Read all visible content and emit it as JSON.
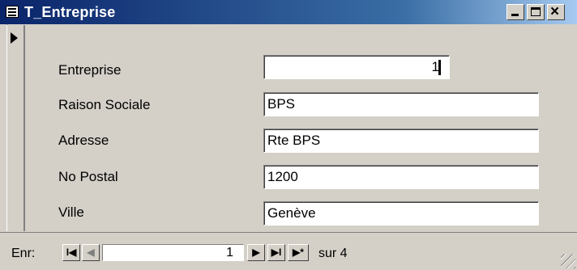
{
  "window": {
    "title": "T_Entreprise",
    "controls": {
      "close_glyph": "×"
    }
  },
  "form": {
    "fields": [
      {
        "label": "Entreprise",
        "value": "1"
      },
      {
        "label": "Raison Sociale",
        "value": "BPS"
      },
      {
        "label": "Adresse",
        "value": "Rte BPS"
      },
      {
        "label": "No Postal",
        "value": "1200"
      },
      {
        "label": "Ville",
        "value": "Genève"
      }
    ]
  },
  "navigation": {
    "label": "Enr:",
    "current_record": "1",
    "total_text": "sur  4",
    "first_glyph": "I◀",
    "prev_glyph": "◀",
    "next_glyph": "▶",
    "last_glyph": "▶I",
    "new_glyph": "▶*"
  },
  "icons": [
    "form-icon",
    "record-selector-arrow-icon",
    "size-grip-icon"
  ]
}
